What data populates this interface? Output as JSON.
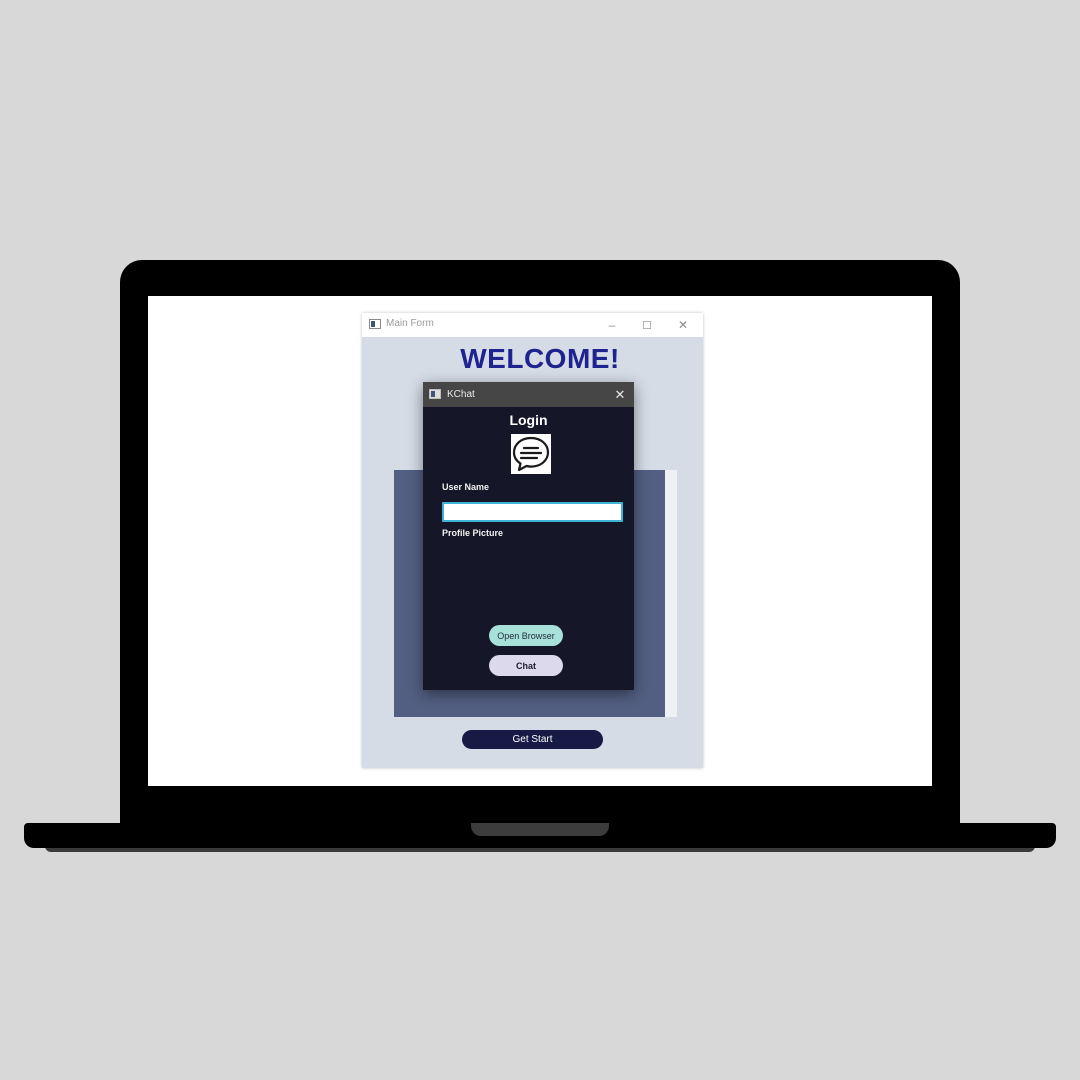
{
  "main_form": {
    "title": "Main Form",
    "minimize_glyph": "–",
    "maximize_glyph": "☐",
    "close_glyph": "✕",
    "welcome": "WELCOME!",
    "get_start_label": "Get Start"
  },
  "kchat": {
    "title": "KChat",
    "close_glyph": "✕",
    "heading": "Login",
    "logo_icon": "chat-bubble-icon",
    "user_name_label": "User Name",
    "user_name_value": "",
    "profile_picture_label": "Profile Picture",
    "open_browser_label": "Open Browser",
    "chat_label": "Chat"
  },
  "colors": {
    "welcome": "#1f2390",
    "kchat_background": "#161629",
    "panel": "#535f82",
    "get_start": "#171a45",
    "open_browser": "#a8e0da",
    "chat": "#dcd9ec",
    "input_border": "#3fb3d3"
  }
}
